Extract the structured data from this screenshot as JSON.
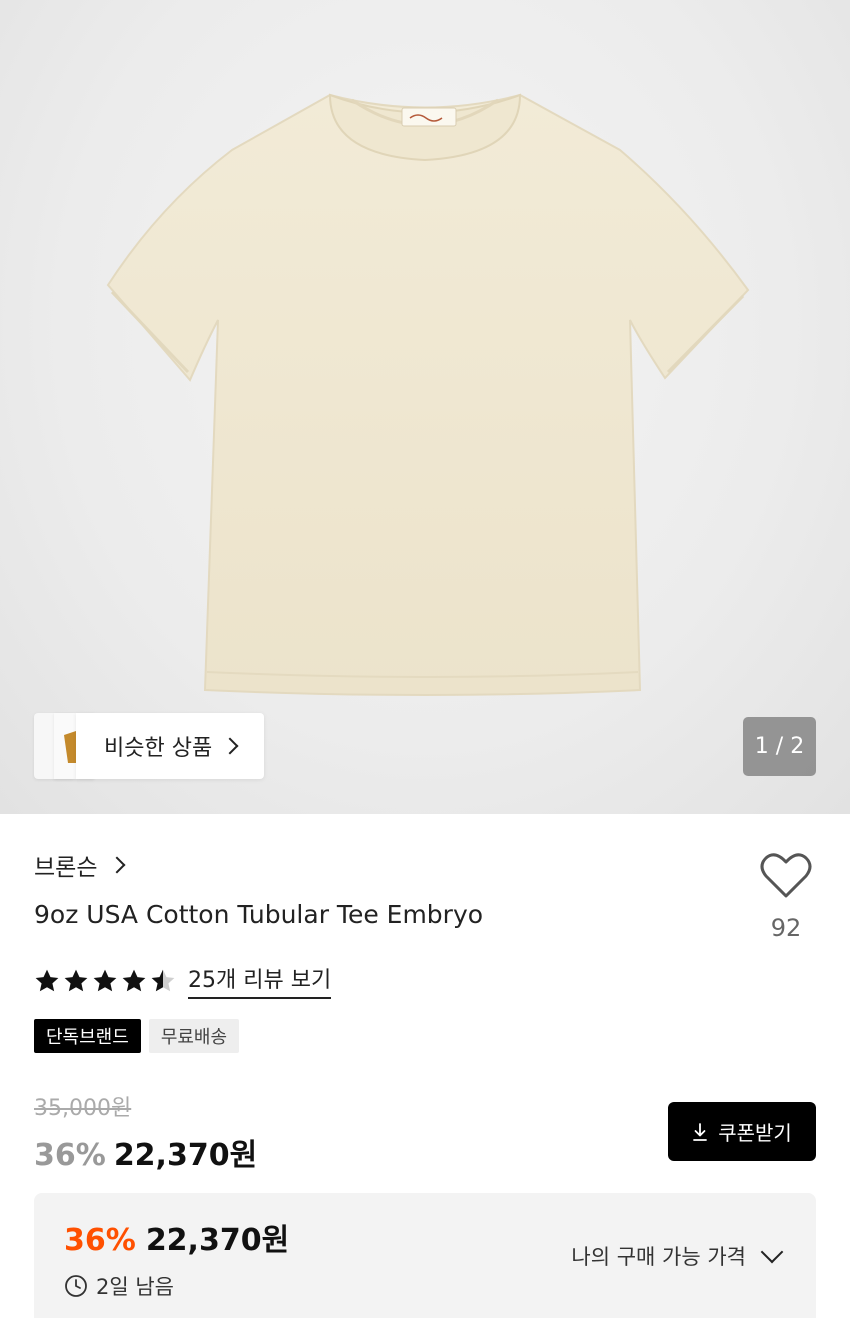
{
  "gallery": {
    "similar_label": "비슷한 상품",
    "counter": "1 / 2",
    "product_color": "#efe8d3"
  },
  "product": {
    "brand": "브론슨",
    "title": "9oz USA Cotton Tubular Tee Embryo",
    "rating": 4.5,
    "review_link": "25개 리뷰 보기",
    "like_count": "92",
    "badges": [
      "단독브랜드",
      "무료배송"
    ]
  },
  "pricing": {
    "original_price": "35,000원",
    "discount_pct": "36%",
    "sale_price": "22,370원",
    "coupon_label": "쿠폰받기"
  },
  "my_price": {
    "discount_pct": "36%",
    "price": "22,370원",
    "time_left": "2일 남음",
    "dropdown_label": "나의 구매 가능 가격"
  }
}
